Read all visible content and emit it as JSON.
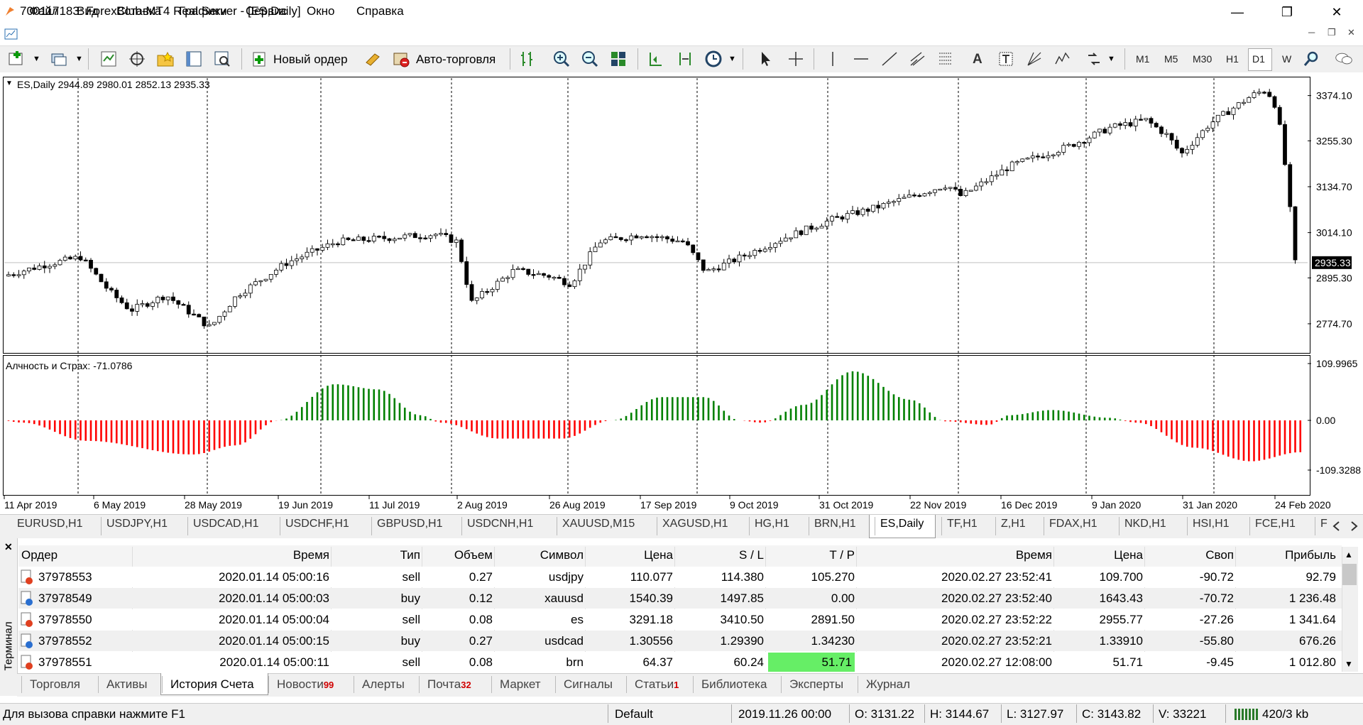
{
  "window": {
    "title": "700117183: ForexClub-MT4 Real Server - [ES,Daily]",
    "controls": [
      "minimize",
      "restore",
      "close"
    ]
  },
  "menu": {
    "items": [
      "Файл",
      "Вид",
      "Вставка",
      "Графики",
      "Сервис",
      "Окно",
      "Справка"
    ]
  },
  "toolbar": {
    "new_order_label": "Новый ордер",
    "autotrading_label": "Авто-торговля",
    "timeframes": [
      "M1",
      "M5",
      "M30",
      "H1",
      "D1",
      "W"
    ],
    "active_timeframe": "D1"
  },
  "chart": {
    "ohlc_label": "ES,Daily  2944.89 2980.01 2852.13 2935.33",
    "indicator_label": "Алчность и Страх: -71.0786",
    "price_axis": [
      "3374.10",
      "3255.30",
      "3134.70",
      "3014.10",
      "2895.30",
      "2774.70"
    ],
    "current_price": "2935.33",
    "indicator_axis": [
      "109.9965",
      "0.00",
      "-109.3288"
    ],
    "date_axis": [
      "11 Apr 2019",
      "6 May 2019",
      "28 May 2019",
      "19 Jun 2019",
      "11 Jul 2019",
      "2 Aug 2019",
      "26 Aug 2019",
      "17 Sep 2019",
      "9 Oct 2019",
      "31 Oct 2019",
      "22 Nov 2019",
      "16 Dec 2019",
      "9 Jan 2020",
      "31 Jan 2020",
      "24 Feb 2020"
    ],
    "colors": {
      "bull": "#ffffff",
      "bear": "#000000",
      "ind_pos": "#008000",
      "ind_neg": "#ff0000",
      "grid": "#000000"
    }
  },
  "symbol_tabs": {
    "items": [
      "EURUSD,H1",
      "USDJPY,H1",
      "USDCAD,H1",
      "USDCHF,H1",
      "GBPUSD,H1",
      "USDCNH,H1",
      "XAUUSD,M15",
      "XAGUSD,H1",
      "HG,H1",
      "BRN,H1",
      "ES,Daily",
      "TF,H1",
      "Z,H1",
      "FDAX,H1",
      "NKD,H1",
      "HSI,H1",
      "FCE,H1",
      "F"
    ],
    "active": "ES,Daily"
  },
  "terminal": {
    "side_label": "Терминал",
    "columns": [
      "Ордер",
      "Время",
      "Тип",
      "Объем",
      "Символ",
      "Цена",
      "S / L",
      "T / P",
      "Время",
      "Цена",
      "Своп",
      "Прибыль"
    ],
    "rows": [
      {
        "order": "37978553",
        "time": "2020.01.14 05:00:16",
        "type": "sell",
        "volume": "0.27",
        "symbol": "usdjpy",
        "price": "110.077",
        "sl": "114.380",
        "tp": "105.270",
        "close_time": "2020.02.27 23:52:41",
        "close_price": "109.700",
        "swap": "-90.72",
        "profit": "92.79"
      },
      {
        "order": "37978549",
        "time": "2020.01.14 05:00:03",
        "type": "buy",
        "volume": "0.12",
        "symbol": "xauusd",
        "price": "1540.39",
        "sl": "1497.85",
        "tp": "0.00",
        "close_time": "2020.02.27 23:52:40",
        "close_price": "1643.43",
        "swap": "-70.72",
        "profit": "1 236.48"
      },
      {
        "order": "37978550",
        "time": "2020.01.14 05:00:04",
        "type": "sell",
        "volume": "0.08",
        "symbol": "es",
        "price": "3291.18",
        "sl": "3410.50",
        "tp": "2891.50",
        "close_time": "2020.02.27 23:52:22",
        "close_price": "2955.77",
        "swap": "-27.26",
        "profit": "1 341.64"
      },
      {
        "order": "37978552",
        "time": "2020.01.14 05:00:15",
        "type": "buy",
        "volume": "0.27",
        "symbol": "usdcad",
        "price": "1.30556",
        "sl": "1.29390",
        "tp": "1.34230",
        "close_time": "2020.02.27 23:52:21",
        "close_price": "1.33910",
        "swap": "-55.80",
        "profit": "676.26"
      },
      {
        "order": "37978551",
        "time": "2020.01.14 05:00:11",
        "type": "sell",
        "volume": "0.08",
        "symbol": "brn",
        "price": "64.37",
        "sl": "60.24",
        "tp": "51.71",
        "close_time": "2020.02.27 12:08:00",
        "close_price": "51.71",
        "swap": "-9.45",
        "profit": "1 012.80"
      }
    ],
    "highlight_color": "#66ee66"
  },
  "bottom_tabs": [
    {
      "label": "Торговля",
      "badge": ""
    },
    {
      "label": "Активы",
      "badge": ""
    },
    {
      "label": "История Счета",
      "badge": ""
    },
    {
      "label": "Новости",
      "badge": "99"
    },
    {
      "label": "Алерты",
      "badge": ""
    },
    {
      "label": "Почта",
      "badge": "32"
    },
    {
      "label": "Маркет",
      "badge": ""
    },
    {
      "label": "Сигналы",
      "badge": ""
    },
    {
      "label": "Статьи",
      "badge": "1"
    },
    {
      "label": "Библиотека",
      "badge": ""
    },
    {
      "label": "Эксперты",
      "badge": ""
    },
    {
      "label": "Журнал",
      "badge": ""
    }
  ],
  "active_bottom_tab": "История Счета",
  "status": {
    "help": "Для вызова справки нажмите F1",
    "profile": "Default",
    "datetime": "2019.11.26 00:00",
    "open": "O: 3131.22",
    "high": "H: 3144.67",
    "low": "L: 3127.97",
    "close": "C: 3143.82",
    "volume": "V: 33221",
    "traffic": "420/3 kb"
  }
}
